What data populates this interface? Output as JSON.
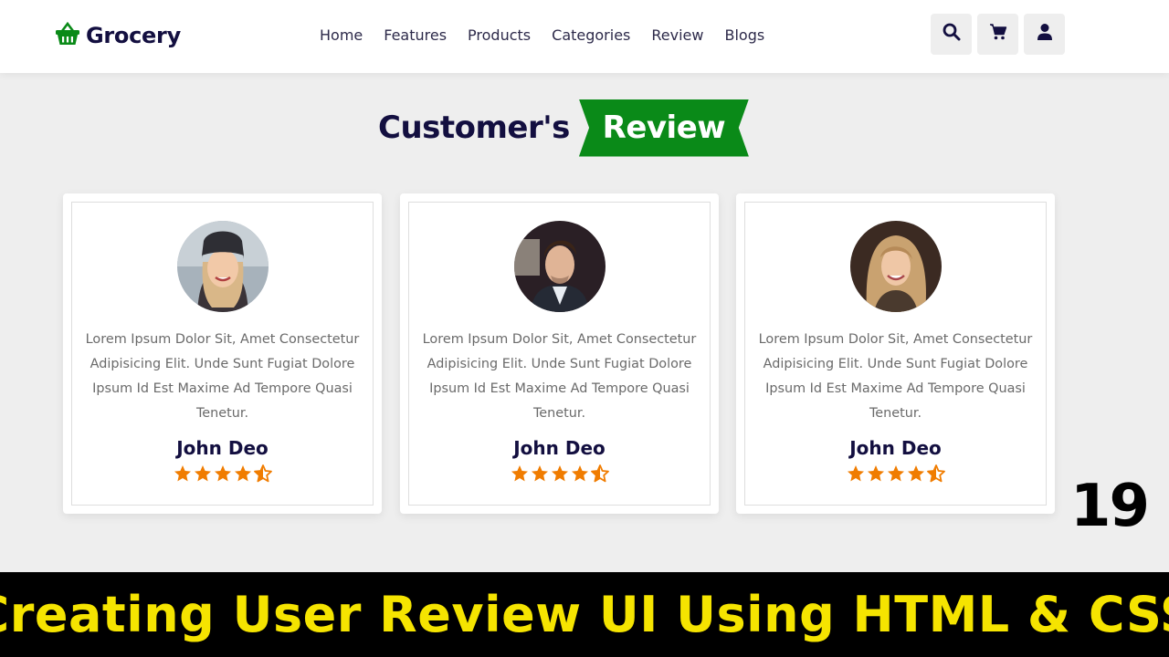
{
  "header": {
    "logo": {
      "text": "Grocery",
      "icon": "shopping-basket-icon",
      "color": "#0a8a18"
    },
    "nav": [
      {
        "label": "Home"
      },
      {
        "label": "Features"
      },
      {
        "label": "Products"
      },
      {
        "label": "Categories"
      },
      {
        "label": "Review"
      },
      {
        "label": "Blogs"
      }
    ],
    "icons": [
      "search-icon",
      "cart-icon",
      "user-icon"
    ]
  },
  "section": {
    "heading_first": "Customer's",
    "heading_highlight": "Review",
    "accent_color": "#0a8a18"
  },
  "reviews": [
    {
      "text": "Lorem Ipsum Dolor Sit, Amet Consectetur Adipisicing Elit. Unde Sunt Fugiat Dolore Ipsum Id Est Maxime Ad Tempore Quasi Tenetur.",
      "name": "John Deo",
      "rating": 4.5
    },
    {
      "text": "Lorem Ipsum Dolor Sit, Amet Consectetur Adipisicing Elit. Unde Sunt Fugiat Dolore Ipsum Id Est Maxime Ad Tempore Quasi Tenetur.",
      "name": "John Deo",
      "rating": 4.5
    },
    {
      "text": "Lorem Ipsum Dolor Sit, Amet Consectetur Adipisicing Elit. Unde Sunt Fugiat Dolore Ipsum Id Est Maxime Ad Tempore Quasi Tenetur.",
      "name": "John Deo",
      "rating": 4.5
    }
  ],
  "star_color": "#f07c00",
  "episode_number": "19",
  "banner": {
    "text": "Creating User Review UI Using HTML & CSS",
    "color": "#f5e400"
  }
}
